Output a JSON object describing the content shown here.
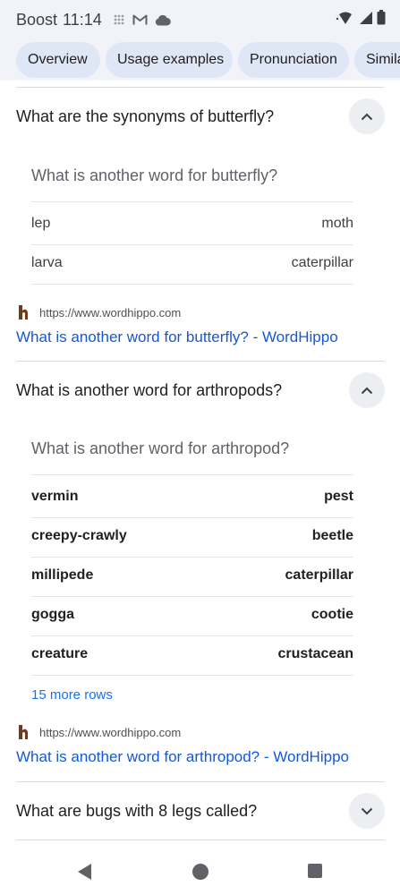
{
  "status_bar": {
    "carrier": "Boost",
    "time": "11:14",
    "icons": [
      "grid-icon",
      "gmail-icon",
      "cloud-icon",
      "wifi-icon",
      "signal-icon",
      "battery-icon"
    ]
  },
  "chips": [
    {
      "label": "Overview"
    },
    {
      "label": "Usage examples"
    },
    {
      "label": "Pronunciation"
    },
    {
      "label": "Simila"
    }
  ],
  "sections": [
    {
      "question": "What are the synonyms of butterfly?",
      "expanded": true,
      "card_title": "What is another word for butterfly?",
      "rows": [
        {
          "left": "lep",
          "right": "moth"
        },
        {
          "left": "larva",
          "right": "caterpillar"
        }
      ],
      "source_url": "https://www.wordhippo.com",
      "source_title": "What is another word for butterfly? - WordHippo"
    },
    {
      "question": "What is another word for arthropods?",
      "expanded": true,
      "card_title": "What is another word for arthropod?",
      "rows": [
        {
          "left": "vermin",
          "right": "pest"
        },
        {
          "left": "creepy-crawly",
          "right": "beetle"
        },
        {
          "left": "millipede",
          "right": "caterpillar"
        },
        {
          "left": "gogga",
          "right": "cootie"
        },
        {
          "left": "creature",
          "right": "crustacean"
        }
      ],
      "more_rows": "15 more rows",
      "source_url": "https://www.wordhippo.com",
      "source_title": "What is another word for arthropod? - WordHippo"
    },
    {
      "question": "What are bugs with 8 legs called?",
      "expanded": false
    }
  ],
  "colors": {
    "link": "#1558d6",
    "chip_bg": "#dfe6f5",
    "bar_bg": "#f1f3f8"
  }
}
